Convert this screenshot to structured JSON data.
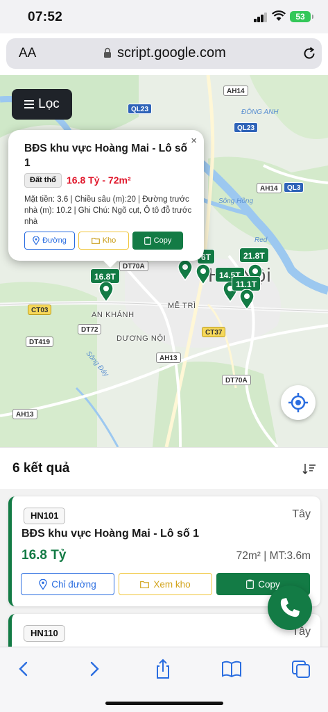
{
  "status_bar": {
    "time": "07:52",
    "battery": "53"
  },
  "browser": {
    "text_size_label": "AA",
    "url": "script.google.com"
  },
  "map": {
    "filter_label": "Lọc",
    "labels": {
      "dong_anh": "ĐÔNG ANH",
      "me_tri": "MỄ TRÌ",
      "an_khanh": "AN KHÁNH",
      "duong_noi": "DƯƠNG NỘI",
      "hanoi": "Hà Nội",
      "song_hong": "Sông Hồng",
      "song_day": "Sông Đáy",
      "red_river": "Red"
    },
    "road_shields": {
      "ah14_top": "AH14",
      "ql23_a": "QL23",
      "ql23_b": "QL23",
      "ah14_mid": "AH14",
      "ql3": "QL3",
      "dt70a_a": "DT70A",
      "ct03": "CT03",
      "dt72": "DT72",
      "dt419": "DT419",
      "ct37": "CT37",
      "ah13_a": "AH13",
      "dt70a_b": "DT70A",
      "ah13_b": "AH13"
    },
    "markers": {
      "m1": "16.8T",
      "m2": "6T",
      "m3": "21.8T",
      "m4": "14.5T",
      "m5": "11.1T"
    }
  },
  "popup": {
    "title": "BĐS khu vực Hoàng Mai - Lô số 1",
    "type": "Đất thổ",
    "price_area": "16.8 Tỷ - 72m²",
    "description": "Mặt tiền: 3.6 | Chiều sâu (m):20 | Đường trước nhà (m): 10.2 | Ghi Chú: Ngõ cụt, Ô tô đỗ trước nhà",
    "btn_road": "Đường",
    "btn_store": "Kho",
    "btn_copy": "Copy",
    "close": "×"
  },
  "results": {
    "count_label": "6 kết quả",
    "items": [
      {
        "code": "HN101",
        "direction": "Tây",
        "title": "BĐS khu vực Hoàng Mai - Lô số 1",
        "price": "16.8 Tỷ",
        "meta": "72m² | MT:3.6m",
        "btn_road": "Chỉ đường",
        "btn_store": "Xem kho",
        "btn_copy": "Copy"
      },
      {
        "code": "HN110",
        "direction": "Tây"
      }
    ]
  },
  "colors": {
    "accent_green": "#137b45",
    "price_red": "#e0172b",
    "link_blue": "#2a6de0",
    "store_yellow": "#f0c63c"
  },
  "icons": {
    "filter": "hamburger-icon",
    "locate": "crosshair-icon",
    "call": "phone-icon",
    "sort": "sort-icon",
    "back": "chevron-left-icon",
    "forward": "chevron-right-icon",
    "share": "share-icon",
    "bookmarks": "book-icon",
    "tabs": "tabs-icon"
  }
}
